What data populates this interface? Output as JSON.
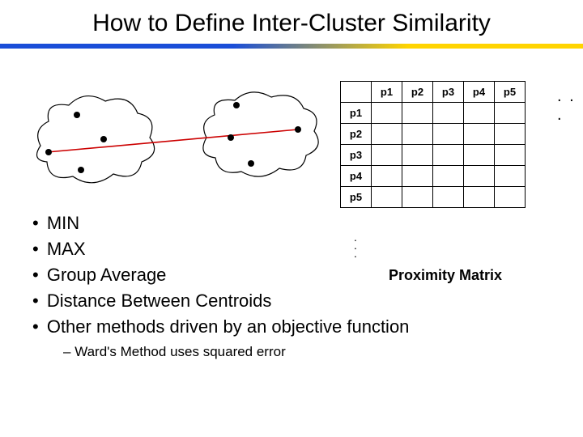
{
  "title": "How to Define Inter-Cluster Similarity",
  "bullets": {
    "items": [
      "MIN",
      "MAX",
      "Group Average",
      "Distance Between Centroids",
      "Other methods driven by an objective function"
    ],
    "sub": "Ward's Method uses squared error"
  },
  "matrix": {
    "cols": [
      "p1",
      "p2",
      "p3",
      "p4",
      "p5"
    ],
    "rows": [
      "p1",
      "p2",
      "p3",
      "p4",
      "p5"
    ],
    "caption": "Proximity Matrix",
    "h_ellipsis": ". . .",
    "v_dot": "."
  }
}
